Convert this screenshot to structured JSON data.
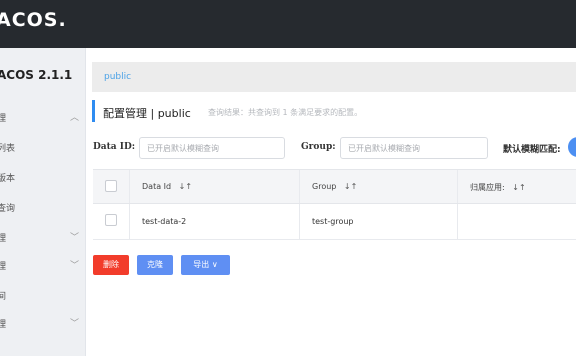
{
  "app": {
    "logo": "ACOS.",
    "version_title": "ACOS 2.1.1"
  },
  "sidebar": {
    "items": [
      {
        "label": "理",
        "chevron": "︿"
      },
      {
        "label": "列表",
        "chevron": ""
      },
      {
        "label": "版本",
        "chevron": ""
      },
      {
        "label": "查询",
        "chevron": ""
      },
      {
        "label": "理",
        "chevron": "﹀"
      },
      {
        "label": "理",
        "chevron": "﹀"
      },
      {
        "label": "间",
        "chevron": ""
      },
      {
        "label": "理",
        "chevron": "﹀"
      }
    ]
  },
  "breadcrumb": {
    "namespace": "public"
  },
  "header": {
    "title": "配置管理  |  public",
    "summary": "查询结果：共查询到 1 条满足要求的配置。"
  },
  "filters": {
    "data_id_label": "Data ID:",
    "data_id_placeholder": "已开启默认模糊查询",
    "group_label": "Group:",
    "group_placeholder": "已开启默认模糊查询",
    "fuzzy_label": "默认模糊匹配:"
  },
  "table": {
    "columns": [
      "Data Id",
      "Group",
      "归属应用:"
    ],
    "sort_icon": "↓↑",
    "rows": [
      {
        "data_id": "test-data-2",
        "group": "test-group",
        "app": ""
      }
    ]
  },
  "actions": {
    "delete_label": "删除",
    "clone_label": "克隆",
    "export_label": "导出 ∨"
  },
  "colors": {
    "topbar": "#262a2f",
    "accent": "#2f8cf1",
    "danger": "#f23c2b",
    "primary_button": "#5f8ff3"
  }
}
